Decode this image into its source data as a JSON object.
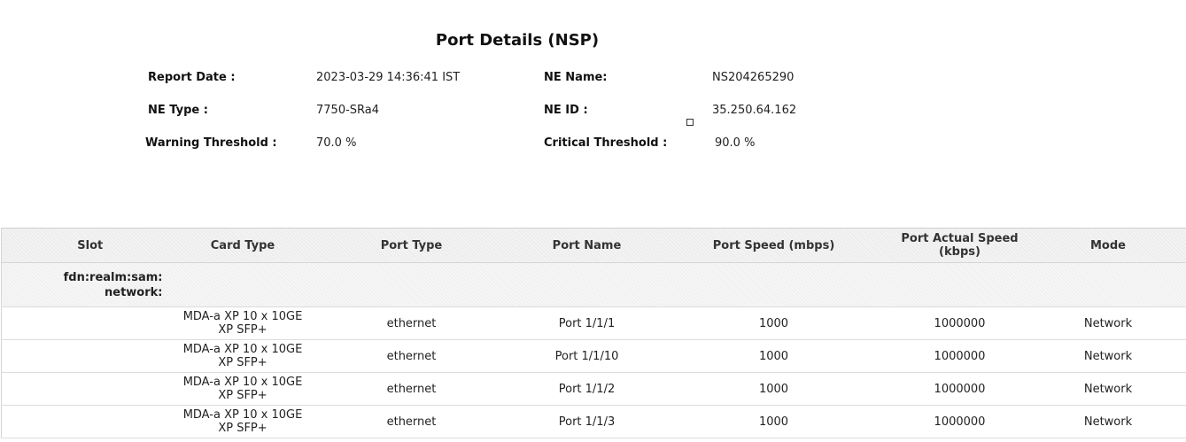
{
  "report": {
    "title": "Port Details (NSP)",
    "report_date_label": "Report Date :",
    "report_date_value": "2023-03-29 14:36:41 IST",
    "ne_name_label": "NE Name:",
    "ne_name_value": "NS204265290",
    "ne_type_label": "NE Type :",
    "ne_type_value": "7750-SRa4",
    "ne_id_label": "NE ID :",
    "ne_id_value": "35.250.64.162",
    "warning_label": "Warning Threshold :",
    "warning_value": "70.0 %",
    "critical_label": "Critical Threshold :",
    "critical_value": "90.0 %"
  },
  "table": {
    "headers": [
      "Slot",
      "Card Type",
      "Port Type",
      "Port Name",
      "Port Speed (mbps)",
      "Port Actual Speed (kbps)",
      "Mode"
    ],
    "group_label_line1": "fdn:realm:sam:",
    "group_label_line2": "network:",
    "rows": [
      [
        "",
        "MDA-a XP 10 x 10GE XP SFP+",
        "ethernet",
        "Port 1/1/1",
        "1000",
        "1000000",
        "Network"
      ],
      [
        "",
        "MDA-a XP 10 x 10GE XP SFP+",
        "ethernet",
        "Port 1/1/10",
        "1000",
        "1000000",
        "Network"
      ],
      [
        "",
        "MDA-a XP 10 x 10GE XP SFP+",
        "ethernet",
        "Port 1/1/2",
        "1000",
        "1000000",
        "Network"
      ],
      [
        "",
        "MDA-a XP 10 x 10GE XP SFP+",
        "ethernet",
        "Port 1/1/3",
        "1000",
        "1000000",
        "Network"
      ]
    ]
  }
}
